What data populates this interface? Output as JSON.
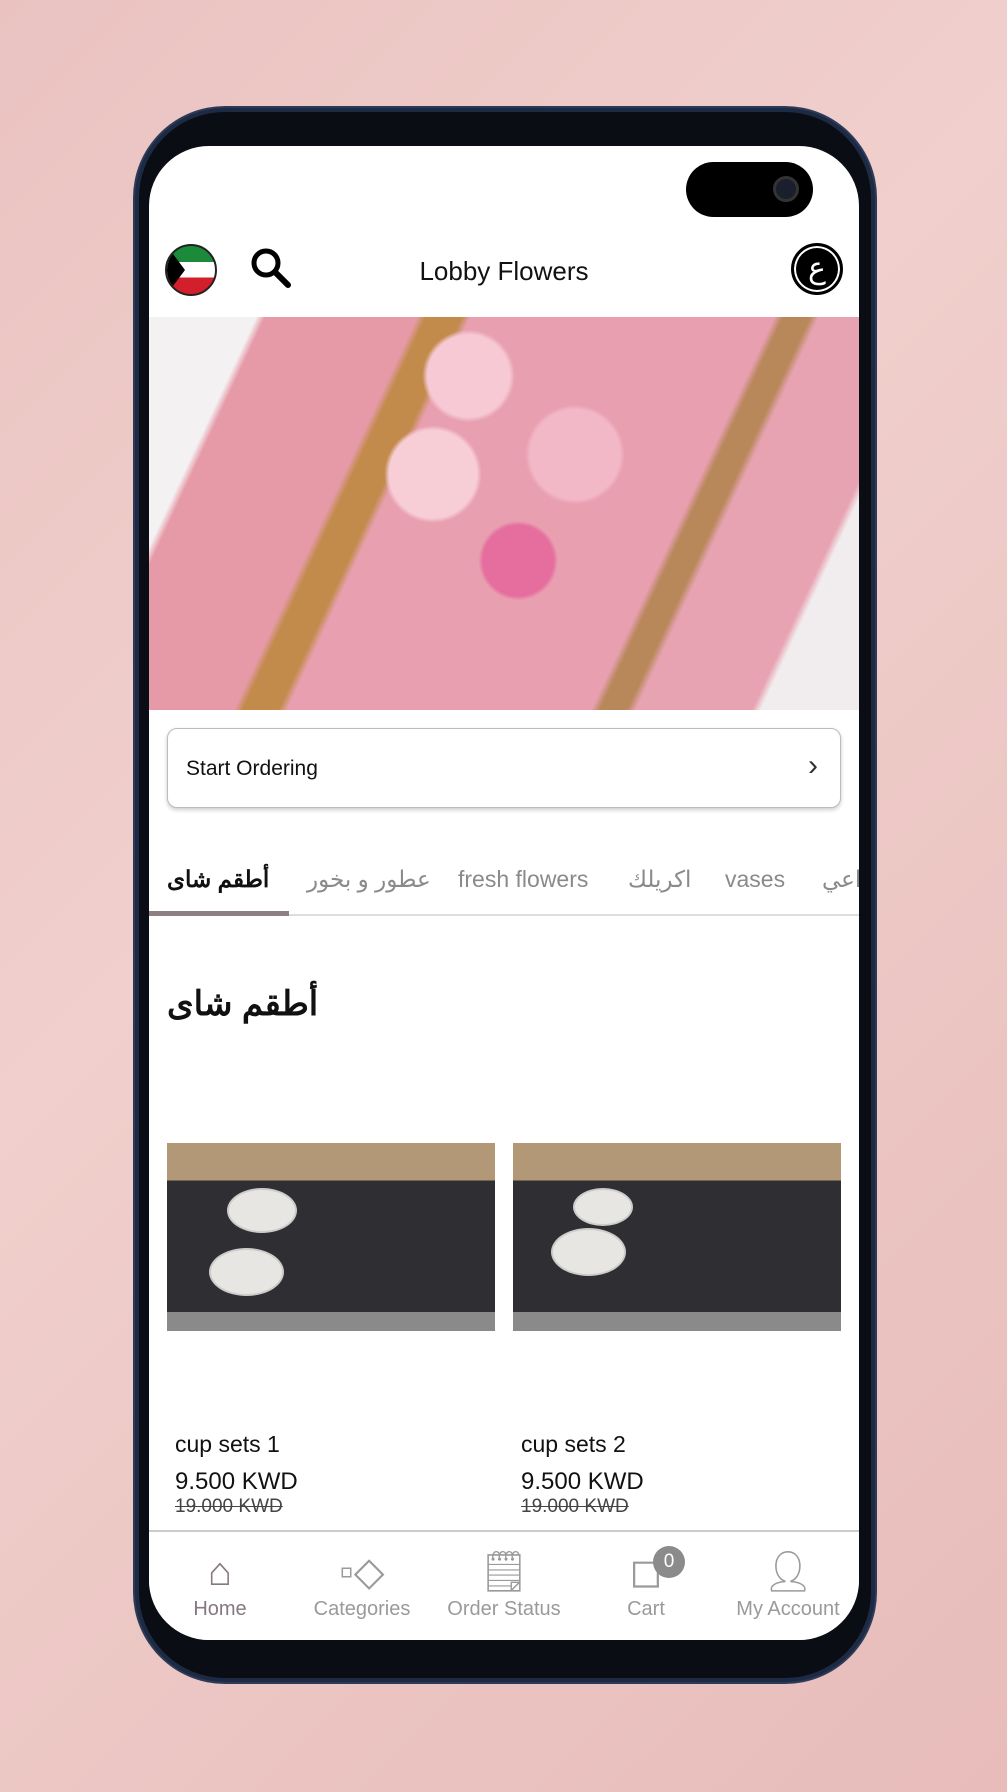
{
  "header": {
    "title": "Lobby Flowers",
    "language_button": "ع",
    "flag": "kuwait-flag",
    "search": "search-icon"
  },
  "start_ordering": {
    "label": "Start Ordering",
    "chevron": "›"
  },
  "tabs": [
    {
      "label": "أطقم شاى",
      "active": true
    },
    {
      "label": "عطور و بخور"
    },
    {
      "label": "fresh flowers"
    },
    {
      "label": "اكريلك"
    },
    {
      "label": "vases"
    },
    {
      "label": "اعي"
    }
  ],
  "section": {
    "title": "أطقم شاى"
  },
  "products": [
    {
      "name": "cup sets 1",
      "price": "9.500 KWD",
      "old_price": "19.000 KWD"
    },
    {
      "name": "cup sets 2",
      "price": "9.500 KWD",
      "old_price": "19.000 KWD"
    }
  ],
  "nav": [
    {
      "label": "Home",
      "icon": "home-icon",
      "active": true
    },
    {
      "label": "Categories",
      "icon": "categories-icon"
    },
    {
      "label": "Order Status",
      "icon": "order-status-icon"
    },
    {
      "label": "Cart",
      "icon": "cart-icon",
      "badge": "0"
    },
    {
      "label": "My Account",
      "icon": "account-icon"
    }
  ],
  "colors": {
    "active_tab_underline": "#8d7f84",
    "nav_active": "#857880",
    "background": "#eac3c1"
  }
}
